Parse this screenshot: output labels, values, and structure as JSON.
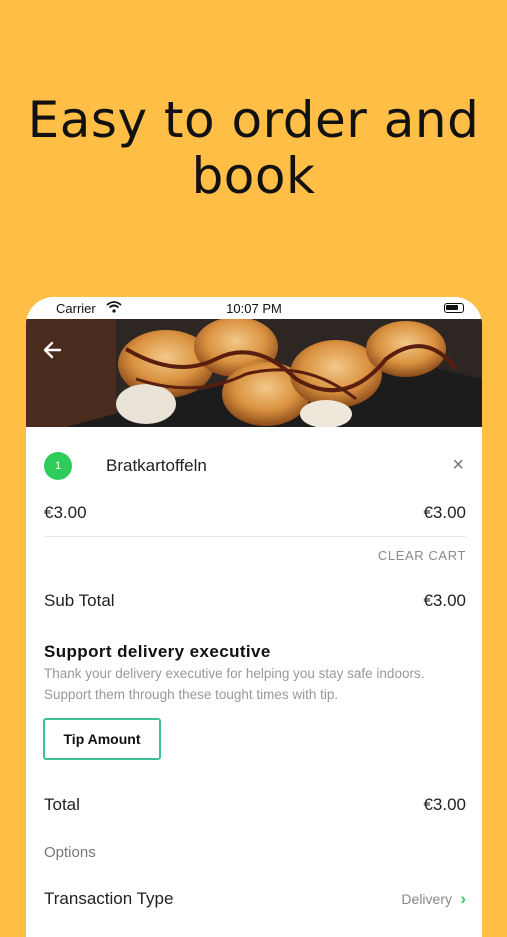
{
  "headline": "Easy to order and book",
  "status_bar": {
    "carrier": "Carrier",
    "time": "10:07 PM"
  },
  "cart": {
    "item": {
      "quantity": "1",
      "name": "Bratkartoffeln",
      "unit_price": "€3.00",
      "line_total": "€3.00"
    },
    "clear_cart_label": "CLEAR CART",
    "sub_total_label": "Sub Total",
    "sub_total_value": "€3.00",
    "support": {
      "title": "Support delivery executive",
      "description": "Thank your delivery executive for helping you stay safe indoors. Support them through these tought times with tip.",
      "tip_button_label": "Tip Amount"
    },
    "total_label": "Total",
    "total_value": "€3.00",
    "options_label": "Options",
    "transaction_type_label": "Transaction Type",
    "transaction_type_value": "Delivery"
  },
  "colors": {
    "background": "#FFBE45",
    "accent_green": "#2ECC5A",
    "tip_border": "#3BC09A"
  },
  "icons": {
    "back": "back-arrow-icon",
    "remove": "close-icon",
    "chevron": "chevron-right-icon",
    "wifi": "wifi-icon",
    "battery": "battery-icon"
  }
}
